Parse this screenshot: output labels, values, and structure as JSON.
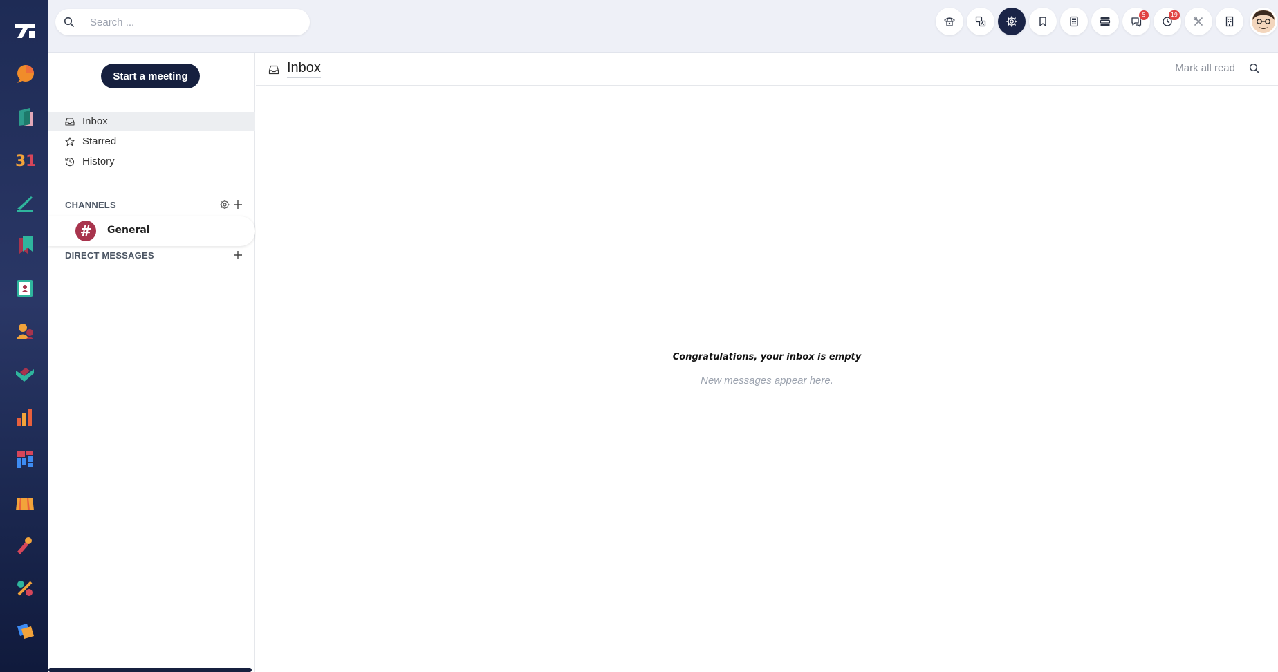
{
  "search": {
    "placeholder": "Search ..."
  },
  "topbar": {
    "buttons": [
      {
        "icon": "voip-phone-icon"
      },
      {
        "icon": "translate-icon"
      },
      {
        "icon": "settings-gear-icon",
        "active": true
      },
      {
        "icon": "bookmark-icon"
      },
      {
        "icon": "calculator-icon"
      },
      {
        "icon": "activity-list-icon"
      },
      {
        "icon": "messages-icon",
        "badge": "5"
      },
      {
        "icon": "clock-icon",
        "badge": "19"
      },
      {
        "icon": "tools-icon"
      },
      {
        "icon": "building-icon"
      }
    ],
    "avatar": "user-avatar"
  },
  "sidebar": {
    "meeting_button": "Start a meeting",
    "nav": [
      {
        "label": "Inbox",
        "icon": "inbox-icon",
        "active": true
      },
      {
        "label": "Starred",
        "icon": "star-icon"
      },
      {
        "label": "History",
        "icon": "history-icon"
      }
    ],
    "channels_label": "CHANNELS",
    "channels": [
      {
        "name": "General",
        "symbol": "#"
      }
    ],
    "direct_messages_label": "DIRECT MESSAGES"
  },
  "main": {
    "title": "Inbox",
    "mark_all_read": "Mark all read",
    "empty_title": "Congratulations, your inbox is empty",
    "empty_subtitle": "New messages appear here."
  },
  "rail": {
    "apps": [
      "discuss-app-icon",
      "documents-app-icon",
      "calendar-app-icon",
      "sign-app-icon",
      "knowledge-app-icon",
      "contacts-app-icon",
      "employees-app-icon",
      "crm-app-icon",
      "reporting-app-icon",
      "dashboards-app-icon",
      "point-of-sale-app-icon",
      "marketing-app-icon",
      "tools-app-icon",
      "apps-store-icon"
    ]
  },
  "colors": {
    "rail_bg": "#1e2b55",
    "accent_dark": "#16203f",
    "badge_red": "#e04343",
    "channel_avatar": "#a8344d"
  }
}
